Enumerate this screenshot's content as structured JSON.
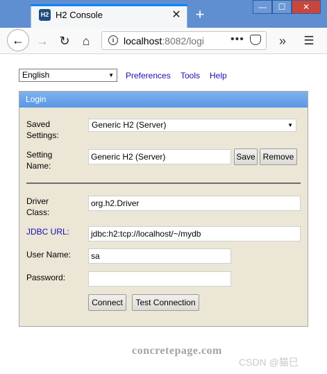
{
  "browser": {
    "tab_title": "H2 Console",
    "favicon_text": "H2",
    "url_host": "localhost",
    "url_rest": ":8082/logi",
    "window_controls": {
      "minimize": "—",
      "maximize": "☐",
      "close": "✕"
    }
  },
  "toolbar": {
    "language": "English",
    "links": [
      "Preferences",
      "Tools",
      "Help"
    ]
  },
  "login": {
    "header": "Login",
    "saved_settings_label_1": "Saved",
    "saved_settings_label_2": "Settings:",
    "saved_settings_value": "Generic H2 (Server)",
    "setting_name_label_1": "Setting",
    "setting_name_label_2": "Name:",
    "setting_name_value": "Generic H2 (Server)",
    "save_label": "Save",
    "remove_label": "Remove",
    "driver_class_label_1": "Driver",
    "driver_class_label_2": "Class:",
    "driver_class_value": "org.h2.Driver",
    "jdbc_url_label": "JDBC URL:",
    "jdbc_url_value": "jdbc:h2:tcp://localhost/~/mydb",
    "user_name_label": "User Name:",
    "user_name_value": "sa",
    "password_label": "Password:",
    "password_value": "",
    "connect_label": "Connect",
    "test_connection_label": "Test Connection"
  },
  "watermarks": {
    "site": "concretepage.com",
    "csdn": "CSDN @猫巳"
  },
  "colors": {
    "titlebar": "#5f8fd1",
    "panel_header": "#5f9eea",
    "panel_bg": "#ebe6d6",
    "link": "#1a0dab"
  }
}
